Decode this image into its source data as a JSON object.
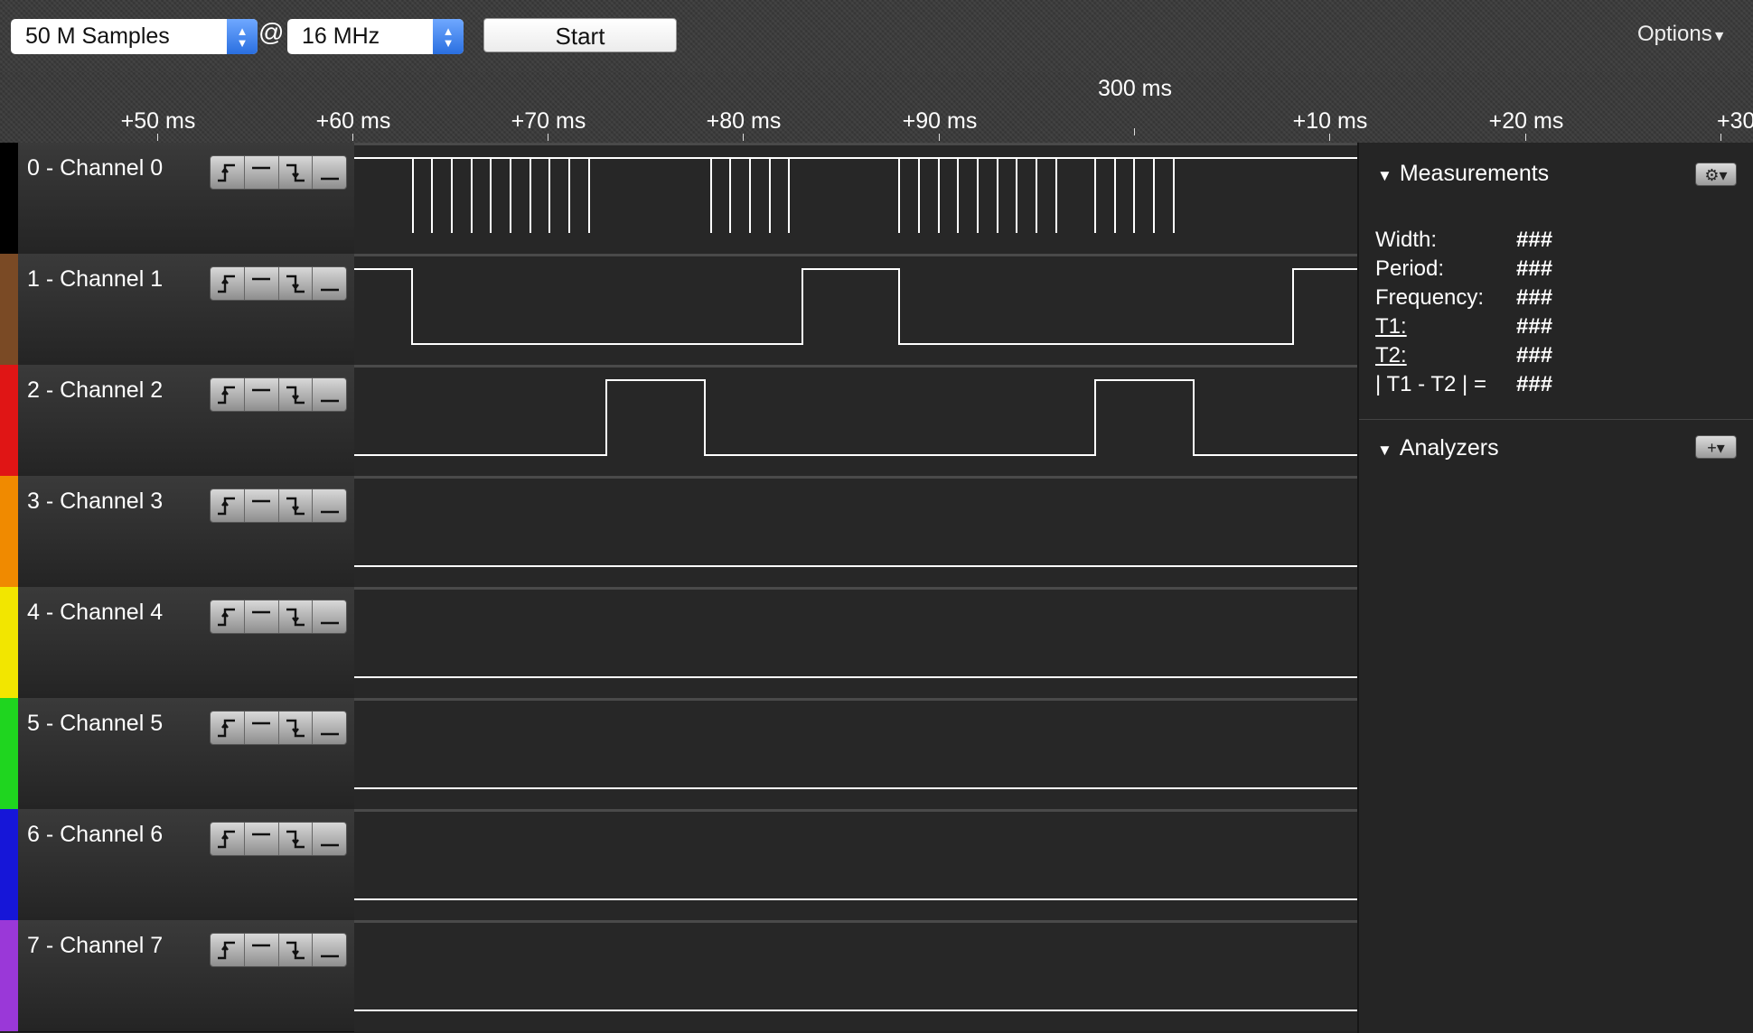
{
  "toolbar": {
    "samples": "50 M Samples",
    "at": "@",
    "rate": "16 MHz",
    "start": "Start",
    "options": "Options"
  },
  "ruler": {
    "center_label": "300 ms",
    "ticks": [
      "+50 ms",
      "+60 ms",
      "+70 ms",
      "+80 ms",
      "+90 ms",
      "+10 ms",
      "+20 ms",
      "+30 ms"
    ]
  },
  "channels": [
    {
      "name": "0 - Channel 0",
      "color": "#000000"
    },
    {
      "name": "1 - Channel 1",
      "color": "#7a4a25"
    },
    {
      "name": "2 - Channel 2",
      "color": "#e01515"
    },
    {
      "name": "3 - Channel 3",
      "color": "#f08a00"
    },
    {
      "name": "4 - Channel 4",
      "color": "#f2e600"
    },
    {
      "name": "5 - Channel 5",
      "color": "#1fd51f"
    },
    {
      "name": "6 - Channel 6",
      "color": "#1616d8"
    },
    {
      "name": "7 - Channel 7",
      "color": "#9a38d8"
    }
  ],
  "trigger_icons": [
    "rising-edge-icon",
    "high-level-icon",
    "falling-edge-icon",
    "low-level-icon"
  ],
  "measurements": {
    "title": "Measurements",
    "rows": [
      {
        "label": "Width:",
        "value": "###"
      },
      {
        "label": "Period:",
        "value": "###"
      },
      {
        "label": "Frequency:",
        "value": "###"
      },
      {
        "label": "T1:",
        "value": "###"
      },
      {
        "label": "T2:",
        "value": "###"
      },
      {
        "label": "| T1 - T2 | =",
        "value": "###"
      }
    ]
  },
  "analyzers": {
    "title": "Analyzers"
  }
}
